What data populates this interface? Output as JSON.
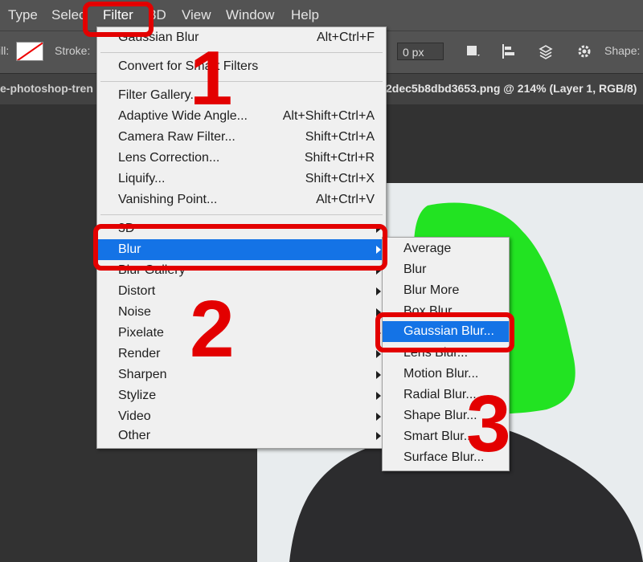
{
  "menubar": {
    "items": [
      "Type",
      "Select",
      "Filter",
      "3D",
      "View",
      "Window",
      "Help"
    ]
  },
  "options": {
    "fill_label": "ill:",
    "stroke_label": "Stroke:",
    "width_value": "0 px",
    "shape_label": "Shape:"
  },
  "tabs": {
    "left": "e-photoshop-tren",
    "right": "2dec5b8dbd3653.png @ 214% (Layer 1, RGB/8)"
  },
  "filter_menu": {
    "items": [
      {
        "label": "Gaussian Blur",
        "shortcut": "Alt+Ctrl+F"
      },
      {
        "label": "Convert for Smart Filters",
        "shortcut": ""
      },
      {
        "label": "Filter Gallery...",
        "shortcut": ""
      },
      {
        "label": "Adaptive Wide Angle...",
        "shortcut": "Alt+Shift+Ctrl+A"
      },
      {
        "label": "Camera Raw Filter...",
        "shortcut": "Shift+Ctrl+A"
      },
      {
        "label": "Lens Correction...",
        "shortcut": "Shift+Ctrl+R"
      },
      {
        "label": "Liquify...",
        "shortcut": "Shift+Ctrl+X"
      },
      {
        "label": "Vanishing Point...",
        "shortcut": "Alt+Ctrl+V"
      },
      {
        "label": "3D",
        "shortcut": ""
      },
      {
        "label": "Blur",
        "shortcut": ""
      },
      {
        "label": "Blur Gallery",
        "shortcut": ""
      },
      {
        "label": "Distort",
        "shortcut": ""
      },
      {
        "label": "Noise",
        "shortcut": ""
      },
      {
        "label": "Pixelate",
        "shortcut": ""
      },
      {
        "label": "Render",
        "shortcut": ""
      },
      {
        "label": "Sharpen",
        "shortcut": ""
      },
      {
        "label": "Stylize",
        "shortcut": ""
      },
      {
        "label": "Video",
        "shortcut": ""
      },
      {
        "label": "Other",
        "shortcut": ""
      }
    ]
  },
  "blur_submenu": {
    "items": [
      "Average",
      "Blur",
      "Blur More",
      "Box Blur...",
      "Gaussian Blur...",
      "Lens Blur...",
      "Motion Blur...",
      "Radial Blur...",
      "Shape Blur...",
      "Smart Blur...",
      "Surface Blur..."
    ]
  },
  "annotations": {
    "step1": "1",
    "step2": "2",
    "step3": "3"
  },
  "colors": {
    "highlight": "#1473e6",
    "annotation": "#e30000",
    "green_mask": "#22e322"
  }
}
